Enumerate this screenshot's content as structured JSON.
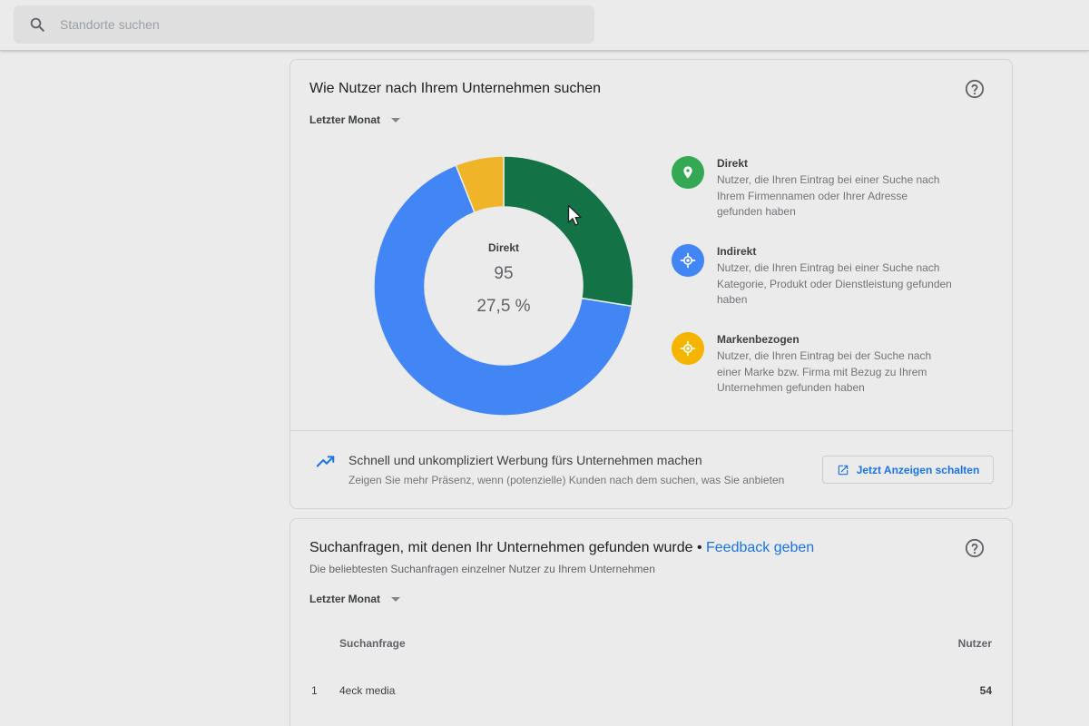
{
  "search": {
    "placeholder": "Standorte suchen"
  },
  "card1": {
    "title": "Wie Nutzer nach Ihrem Unternehmen suchen",
    "period": "Letzter Monat",
    "center": {
      "label": "Direkt",
      "value": "95",
      "percent": "27,5 %"
    },
    "legend": [
      {
        "title": "Direkt",
        "desc": "Nutzer, die Ihren Eintrag bei einer Suche nach Ihrem Firmennamen oder Ihrer Adresse gefunden haben",
        "color": "#34a853"
      },
      {
        "title": "Indirekt",
        "desc": "Nutzer, die Ihren Eintrag bei einer Suche nach Kategorie, Produkt oder Dienstleistung gefunden haben",
        "color": "#4285f4"
      },
      {
        "title": "Markenbezogen",
        "desc": "Nutzer, die Ihren Eintrag bei der Suche nach einer Marke bzw. Firma mit Bezug zu Ihrem Unternehmen gefunden haben",
        "color": "#f4b400"
      }
    ],
    "promo": {
      "title": "Schnell und unkompliziert Werbung fürs Unternehmen machen",
      "subtitle": "Zeigen Sie mehr Präsenz, wenn (potenzielle) Kunden nach dem suchen, was Sie anbieten",
      "button": "Jetzt Anzeigen schalten"
    }
  },
  "chart_data": {
    "type": "pie",
    "categories": [
      "Direkt",
      "Indirekt",
      "Markenbezogen"
    ],
    "values": [
      27.5,
      66.5,
      6.0
    ],
    "colors": [
      "#137347",
      "#4285f4",
      "#f0b429"
    ]
  },
  "card2": {
    "title": "Suchanfragen, mit denen Ihr Unternehmen gefunden wurde",
    "separator": " • ",
    "feedback": "Feedback geben",
    "subtitle": "Die beliebtesten Suchanfragen einzelner Nutzer zu Ihrem Unternehmen",
    "period": "Letzter Monat",
    "col_query": "Suchanfrage",
    "col_users": "Nutzer",
    "rows": [
      {
        "idx": "1",
        "query": "4eck media",
        "users": "54"
      }
    ]
  }
}
